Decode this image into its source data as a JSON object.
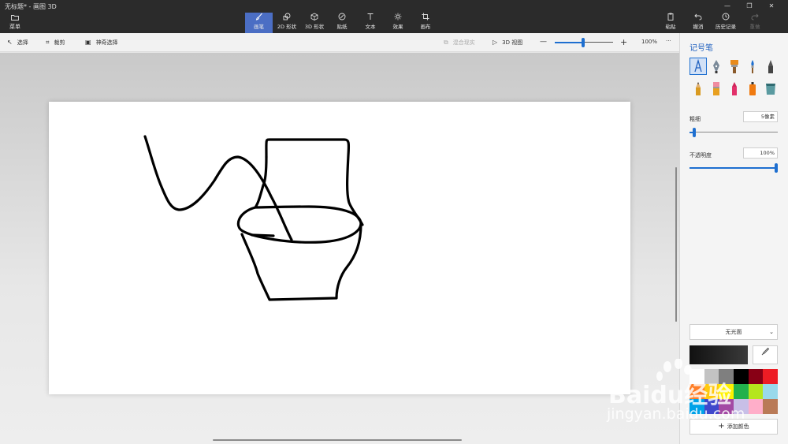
{
  "window": {
    "title": "无标题* - 画图 3D",
    "controls": [
      "—",
      "❐",
      "✕"
    ]
  },
  "menu": {
    "label": "菜单"
  },
  "toolbar": {
    "tools": [
      {
        "id": "brushes",
        "label": "画笔",
        "icon": "brush-icon",
        "active": true
      },
      {
        "id": "shapes2d",
        "label": "2D 形状",
        "icon": "shapes-2d-icon",
        "active": false
      },
      {
        "id": "shapes3d",
        "label": "3D 形状",
        "icon": "cube-icon",
        "active": false
      },
      {
        "id": "stickers",
        "label": "贴纸",
        "icon": "sticker-icon",
        "active": false
      },
      {
        "id": "text",
        "label": "文本",
        "icon": "text-icon",
        "active": false
      },
      {
        "id": "effects",
        "label": "效果",
        "icon": "sun-icon",
        "active": false
      },
      {
        "id": "canvas",
        "label": "画布",
        "icon": "crop-icon",
        "active": false
      }
    ],
    "right": [
      {
        "id": "paste",
        "label": "粘贴",
        "icon": "paste-icon",
        "disabled": false
      },
      {
        "id": "undo",
        "label": "撤消",
        "icon": "undo-icon",
        "disabled": false
      },
      {
        "id": "history",
        "label": "历史记录",
        "icon": "history-icon",
        "disabled": false
      },
      {
        "id": "redo",
        "label": "重做",
        "icon": "redo-icon",
        "disabled": true
      }
    ]
  },
  "subbar": {
    "select": "选择",
    "crop": "裁剪",
    "magic_select": "神奇选择",
    "mixed_reality": "混合现实",
    "view3d": "3D 视图",
    "zoom_minus": "—",
    "zoom_plus": "+",
    "zoom": "100%",
    "more": "···",
    "zoom_level": 0.5
  },
  "panel": {
    "title": "记号笔",
    "brushes": [
      {
        "name": "marker-brush-icon",
        "selected": true
      },
      {
        "name": "calligraphy-pen-icon",
        "selected": false
      },
      {
        "name": "oil-brush-icon",
        "selected": false
      },
      {
        "name": "watercolor-icon",
        "selected": false
      },
      {
        "name": "pixel-pen-icon",
        "selected": false
      },
      {
        "name": "pencil-icon",
        "selected": false
      },
      {
        "name": "eraser-icon",
        "selected": false
      },
      {
        "name": "crayon-icon",
        "selected": false
      },
      {
        "name": "spray-can-icon",
        "selected": false
      },
      {
        "name": "fill-bucket-icon",
        "selected": false
      }
    ],
    "thickness_label": "粗细",
    "thickness_value": "5像素",
    "thickness_level": 0.05,
    "opacity_label": "不透明度",
    "opacity_value": "100%",
    "opacity_level": 1.0,
    "finish": "无光面",
    "add_color": "添加颜色",
    "current_color": "#111111",
    "palette": [
      "#ffffff",
      "#c3c3c3",
      "#7f7f7f",
      "#000000",
      "#880015",
      "#ed1c24",
      "#ff7f27",
      "#ffc90e",
      "#fff200",
      "#22b14c",
      "#b5e61d",
      "#99d9ea",
      "#00a2e8",
      "#3f48cc",
      "#a349a4",
      "#c8bfe7",
      "#ffaec9",
      "#b97a57"
    ]
  },
  "watermark": {
    "main": "Baidu经验",
    "sub": "jingyan.baidu.com"
  }
}
